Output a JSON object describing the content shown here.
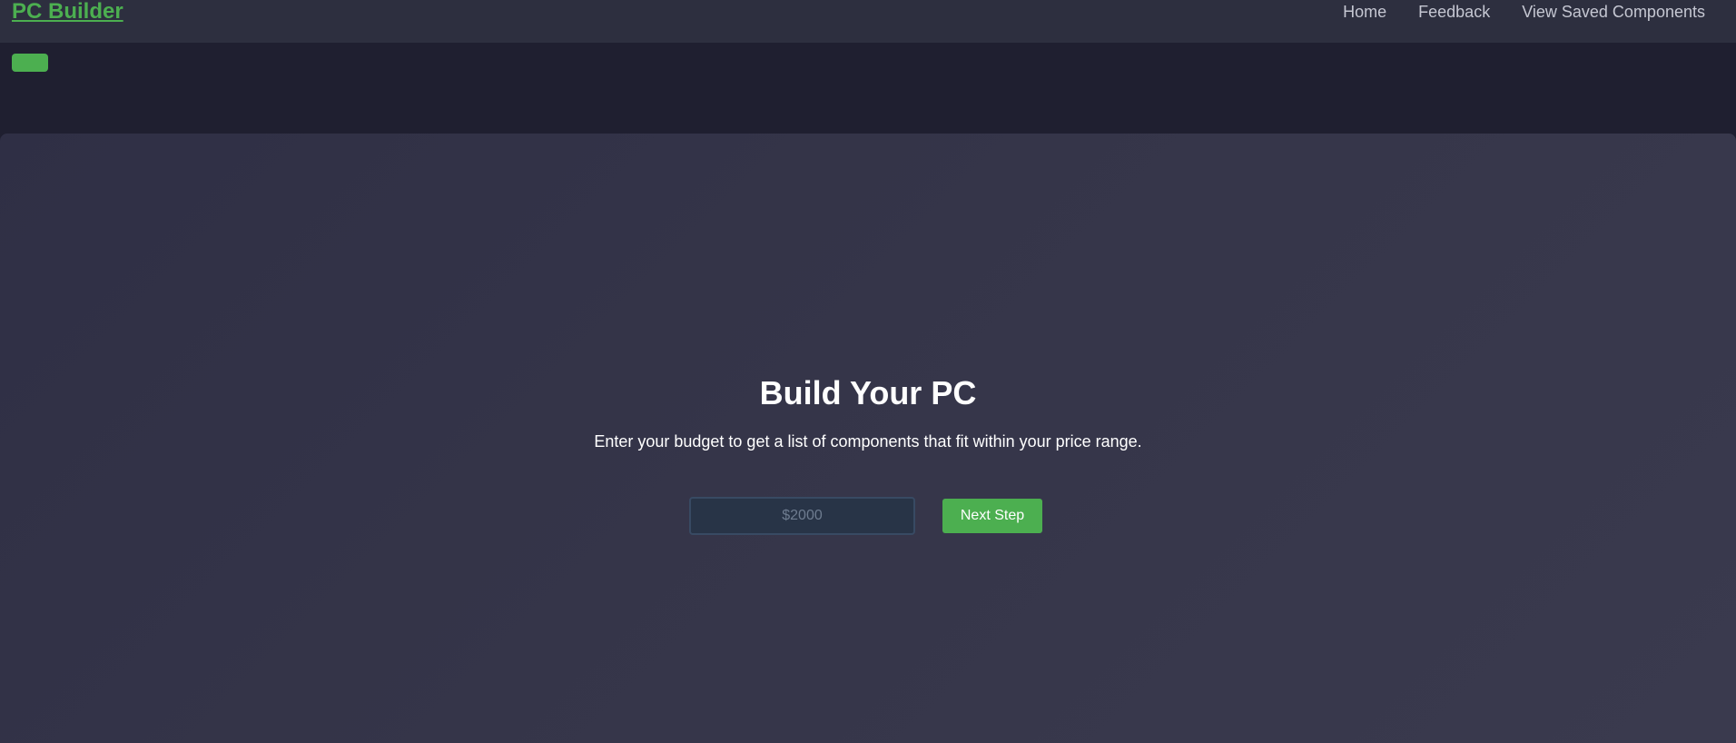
{
  "navbar": {
    "brand": "PC Builder",
    "links": [
      {
        "label": "Home"
      },
      {
        "label": "Feedback"
      },
      {
        "label": "View Saved Components"
      }
    ]
  },
  "hero": {
    "title": "Build Your PC",
    "subtitle": "Enter your budget to get a list of components that fit within your price range.",
    "budget_input": {
      "value": "",
      "placeholder": "$2000"
    },
    "next_button_label": "Next Step"
  },
  "colors": {
    "accent": "#4caf50",
    "navbar_bg": "#2d2f3f",
    "page_bg": "#1f1f30",
    "hero_bg": "#353549",
    "input_bg": "#283447"
  }
}
